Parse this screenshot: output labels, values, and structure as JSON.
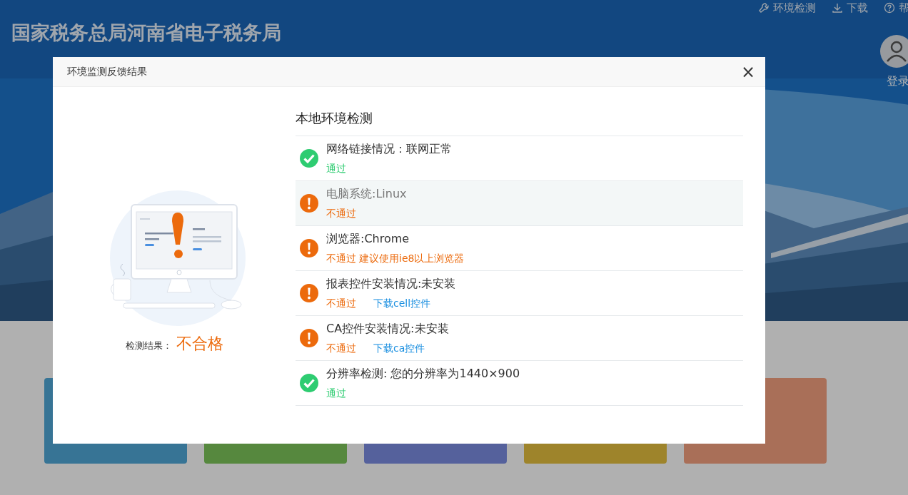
{
  "site": {
    "title": "国家税务总局河南省电子税务局",
    "nav": [
      {
        "label": "环境检测",
        "kind": "wrench"
      },
      {
        "label": "下载",
        "kind": "download"
      },
      {
        "label": "帮",
        "kind": "help"
      }
    ],
    "login": {
      "label": "登录"
    }
  },
  "dialog": {
    "title": "环境监测反馈结果",
    "close": "×",
    "result_label": "检测结果：",
    "result": "不合格",
    "heading": "本地环境检测",
    "checks": [
      {
        "title": "网络链接情况：联网正常",
        "passed": true,
        "highlighted": false,
        "status": "通过"
      },
      {
        "title": "电脑系统:Linux",
        "passed": false,
        "highlighted": true,
        "status": "不通过"
      },
      {
        "title": "浏览器:Chrome",
        "passed": false,
        "highlighted": false,
        "status": "不通过",
        "note": "建议使用ie8以上浏览器"
      },
      {
        "title": "报表控件安装情况:未安装",
        "passed": false,
        "highlighted": false,
        "status": "不通过",
        "link": "下载cell控件"
      },
      {
        "title": "CA控件安装情况:未安装",
        "passed": false,
        "highlighted": false,
        "status": "不通过",
        "link": "下载ca控件"
      },
      {
        "title": "分辨率检测: 您的分辨率为1440×900",
        "passed": true,
        "highlighted": false,
        "status": "通过"
      }
    ]
  }
}
